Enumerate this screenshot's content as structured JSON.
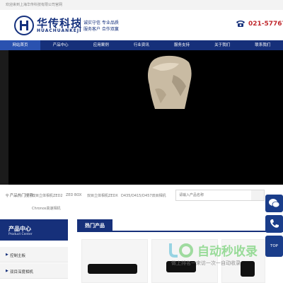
{
  "topbar": {
    "welcome": "欢迎来到上海华传科技有限公司官网"
  },
  "header": {
    "logo_cn": "华传科技",
    "logo_en": "HUACHUANKEJI",
    "slogan_1": "诚实守信 专业品质",
    "slogan_2": "服务客户 合作双赢",
    "phone": "021-57767220",
    "phone_icon": "phone-icon"
  },
  "nav": {
    "items": [
      "网站首页",
      "产品中心",
      "应用案例",
      "行业资讯",
      "服务支持",
      "关于我们",
      "联系我们"
    ],
    "active_index": 0
  },
  "hot_search": {
    "label": "产品热门搜索：",
    "links": [
      "双目立体相机ZED2",
      "ZED BOX",
      "双目立体相机ZEDX",
      "D435/D415/D457双目相机",
      "Chronos高速相机"
    ],
    "placeholder": "请输入产品名称"
  },
  "sidebar": {
    "title_cn": "产品中心",
    "title_en": "Product Center",
    "items": [
      "控制主板",
      "双目深度相机"
    ]
  },
  "hot_products": {
    "title": "热门产品"
  },
  "float_tools": {
    "top_label": "TOP",
    "wechat_icon": "wechat-icon",
    "phone_icon": "phone-icon"
  },
  "watermark": {
    "text": "自动秒收录",
    "sub": "做上排名一来访一次一自动收录"
  },
  "colors": {
    "brand": "#16307a",
    "accent": "#2a52b0",
    "phone": "#c0282d"
  }
}
